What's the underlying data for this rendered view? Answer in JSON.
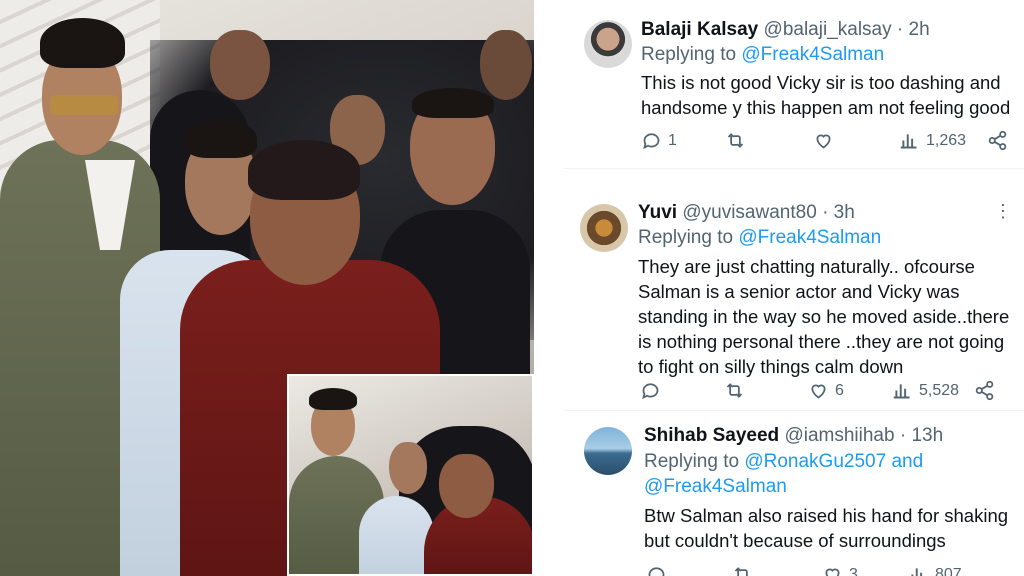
{
  "tweets": [
    {
      "name": "Balaji Kalsay",
      "handle": "@balaji_kalsay",
      "sep": "·",
      "time": "2h",
      "replying_label": "Replying to",
      "replying_to": "@Freak4Salman",
      "lines": [
        "This is not good Vicky sir is too dashing and",
        "handsome y this happen  am not feeling good"
      ],
      "replies": "1",
      "retweets": "",
      "likes": "",
      "views": "1,263"
    },
    {
      "name": "Yuvi",
      "handle": "@yuvisawant80",
      "sep": "·",
      "time": "3h",
      "replying_label": "Replying to",
      "replying_to": "@Freak4Salman",
      "lines": [
        "They are just chatting naturally.. ofcourse",
        "Salman is a senior actor and Vicky was",
        "standing in the way so he moved aside..there",
        "is nothing personal there ..they are not going",
        "to fight on silly things calm down"
      ],
      "replies": "",
      "retweets": "",
      "likes": "6",
      "views": "5,528"
    },
    {
      "name": "Shihab Sayeed",
      "handle": "@iamshiihab",
      "sep": "·",
      "time": "13h",
      "replying_label": "Replying to",
      "replying_to": "@RonakGu2507 and",
      "replying_to_2": "@Freak4Salman",
      "lines": [
        "Btw Salman also raised his hand for shaking",
        "but couldn't because of surroundings"
      ],
      "replies": "",
      "retweets": "",
      "likes": "3",
      "views": "807"
    }
  ],
  "icons": {
    "more": "more-icon",
    "reply": "reply-icon",
    "retweet": "retweet-icon",
    "like": "like-icon",
    "views": "views-icon",
    "share": "share-icon"
  },
  "colors": {
    "link": "#1d9bf0",
    "secondary_text": "#536471",
    "primary_text": "#0f1419"
  }
}
